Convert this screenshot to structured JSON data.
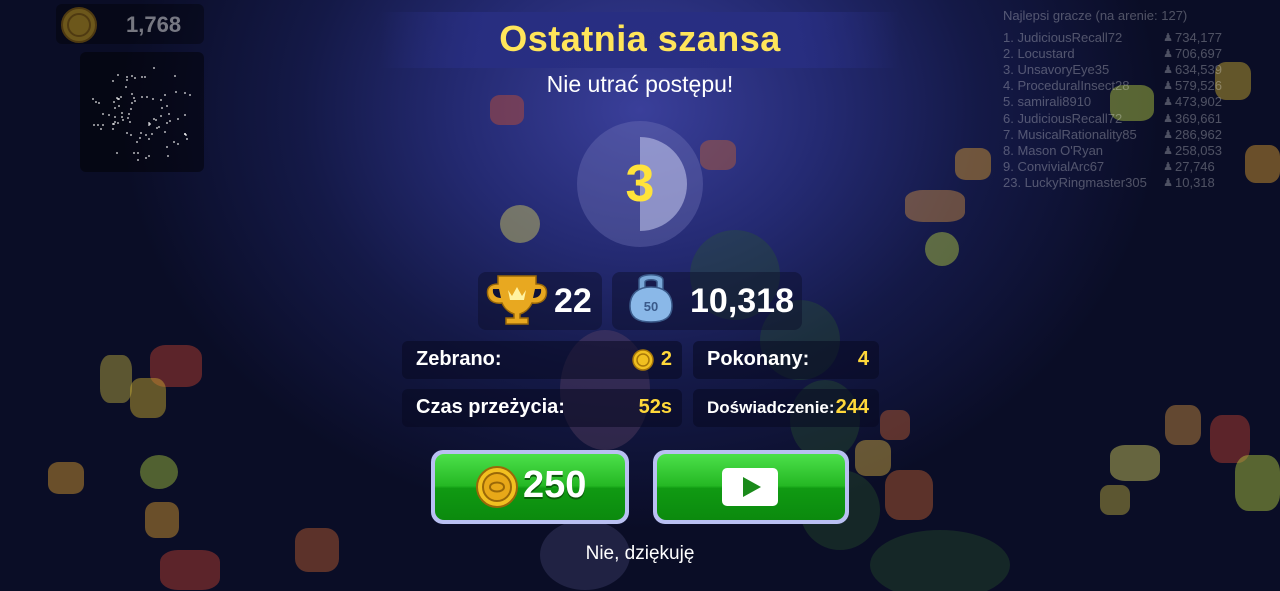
{
  "hud": {
    "coins": "1,768",
    "icons": {
      "coin": "coin-icon",
      "minimap": "minimap"
    }
  },
  "leaderboard": {
    "title": "Najlepsi gracze (na arenie: 127)",
    "entries": [
      {
        "name": "1. JudiciousRecall72",
        "score": "734,177"
      },
      {
        "name": "2. Locustard",
        "score": "706,697"
      },
      {
        "name": "3. UnsavoryEye35",
        "score": "634,539"
      },
      {
        "name": "4. ProceduralInsect28",
        "score": "579,526"
      },
      {
        "name": "5. samirali8910",
        "score": "473,902"
      },
      {
        "name": "6. JudiciousRecall72",
        "score": "369,661"
      },
      {
        "name": "7. MusicalRationality85",
        "score": "286,962"
      },
      {
        "name": "8. Mason O'Ryan",
        "score": "258,053"
      },
      {
        "name": "9. ConvivialArc67",
        "score": "27,746"
      },
      {
        "name": "23. LuckyRingmaster305",
        "score": "10,318"
      }
    ]
  },
  "dialog": {
    "title": "Ostatnia szansa",
    "subtitle": "Nie utrać postępu!",
    "countdown": "3",
    "countdown_progress": 0.5,
    "rank": "22",
    "mass": "10,318",
    "kettlebell_label": "50",
    "stats": {
      "collected_label": "Zebrano:",
      "collected_value": "2",
      "defeated_label": "Pokonany:",
      "defeated_value": "4",
      "survival_label": "Czas przeżycia:",
      "survival_value": "52s",
      "experience_label": "Doświadczenie:",
      "experience_value": "244"
    },
    "buy_price": "250",
    "decline_label": "Nie, dziękuję"
  },
  "colors": {
    "title": "#ffe55a",
    "accent": "#ffd83a",
    "button_green": "#25b824",
    "button_border": "#b9c0f2"
  }
}
